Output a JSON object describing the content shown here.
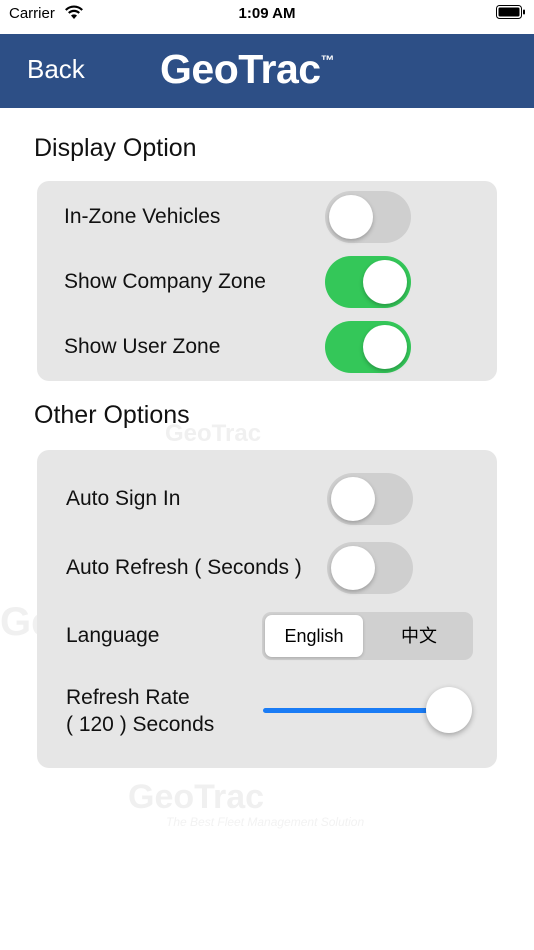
{
  "status_bar": {
    "carrier": "Carrier",
    "time": "1:09 AM"
  },
  "nav": {
    "back_label": "Back",
    "brand": "GeoTrac",
    "trademark": "™"
  },
  "watermark": {
    "brand": "GeoTrac",
    "tagline": "The Best Fleet Management Solution"
  },
  "display_section": {
    "title": "Display Option",
    "rows": [
      {
        "label": "In-Zone Vehicles",
        "on": false
      },
      {
        "label": "Show Company Zone",
        "on": true
      },
      {
        "label": "Show User Zone",
        "on": true
      }
    ]
  },
  "other_section": {
    "title": "Other Options",
    "auto_sign_in": {
      "label": "Auto Sign In",
      "on": false
    },
    "auto_refresh": {
      "label": "Auto Refresh ( Seconds )",
      "on": false
    },
    "language": {
      "label": "Language",
      "options": [
        "English",
        "中文"
      ],
      "selected": "English"
    },
    "refresh_rate": {
      "label_line1": "Refresh Rate",
      "label_line2": "( 120 ) Seconds",
      "value": 120,
      "fraction": 1.0
    }
  },
  "colors": {
    "nav_bg": "#2d4f86",
    "toggle_on": "#34c759",
    "toggle_off": "#cfcfcf",
    "slider": "#1a7cf5",
    "panel_bg": "#e6e6e6"
  }
}
